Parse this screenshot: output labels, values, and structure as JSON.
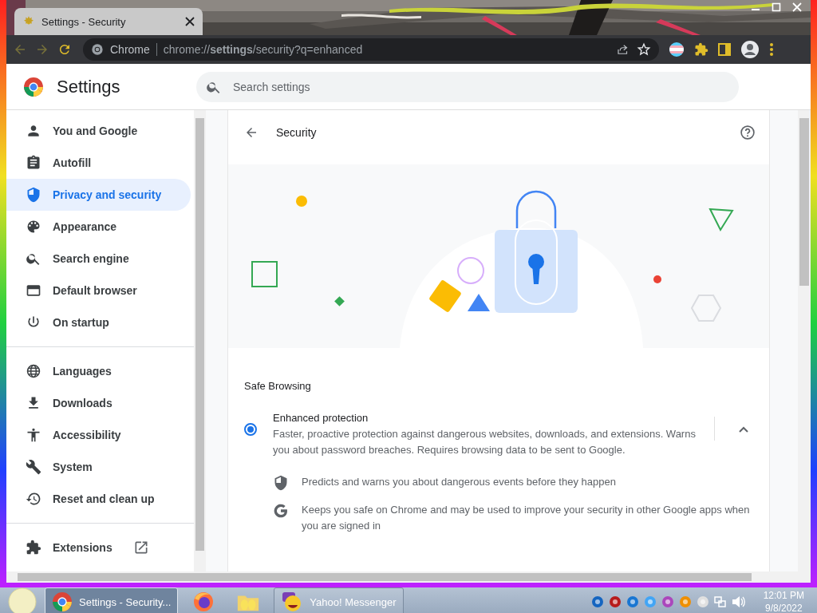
{
  "window": {
    "tab_title": "Settings - Security"
  },
  "toolbar": {
    "site_label": "Chrome",
    "url": "chrome://**settings**/security?q=enhanced"
  },
  "settings_header": {
    "title": "Settings",
    "search_placeholder": "Search settings"
  },
  "sidebar": {
    "groups": [
      [
        {
          "label": "You and Google",
          "selected": false,
          "external_link": false
        },
        {
          "label": "Autofill",
          "selected": false,
          "external_link": false
        },
        {
          "label": "Privacy and security",
          "selected": true,
          "external_link": false
        },
        {
          "label": "Appearance",
          "selected": false,
          "external_link": false
        },
        {
          "label": "Search engine",
          "selected": false,
          "external_link": false
        },
        {
          "label": "Default browser",
          "selected": false,
          "external_link": false
        },
        {
          "label": "On startup",
          "selected": false,
          "external_link": false
        }
      ],
      [
        {
          "label": "Languages",
          "selected": false,
          "external_link": false
        },
        {
          "label": "Downloads",
          "selected": false,
          "external_link": false
        },
        {
          "label": "Accessibility",
          "selected": false,
          "external_link": false
        },
        {
          "label": "System",
          "selected": false,
          "external_link": false
        },
        {
          "label": "Reset and clean up",
          "selected": false,
          "external_link": false
        }
      ],
      [
        {
          "label": "Extensions",
          "selected": false,
          "external_link": true
        }
      ]
    ]
  },
  "page": {
    "title": "Security",
    "section_heading": "Safe Browsing",
    "options": [
      {
        "title": "Enhanced protection",
        "description": "Faster, proactive protection against dangerous websites, downloads, and extensions. Warns you about password breaches. Requires browsing data to be sent to Google.",
        "selected": true,
        "expanded": true,
        "features": [
          "Predicts and warns you about dangerous events before they happen",
          "Keeps you safe on Chrome and may be used to improve your security in other Google apps when you are signed in"
        ]
      }
    ]
  },
  "taskbar": {
    "buttons": [
      {
        "label": "Settings - Security...",
        "selected": true
      },
      {
        "selected": false
      },
      {
        "selected": false
      },
      {
        "label": "Yahoo! Messenger",
        "selected": false
      }
    ],
    "time": "12:01 PM",
    "date": "9/8/2022"
  }
}
